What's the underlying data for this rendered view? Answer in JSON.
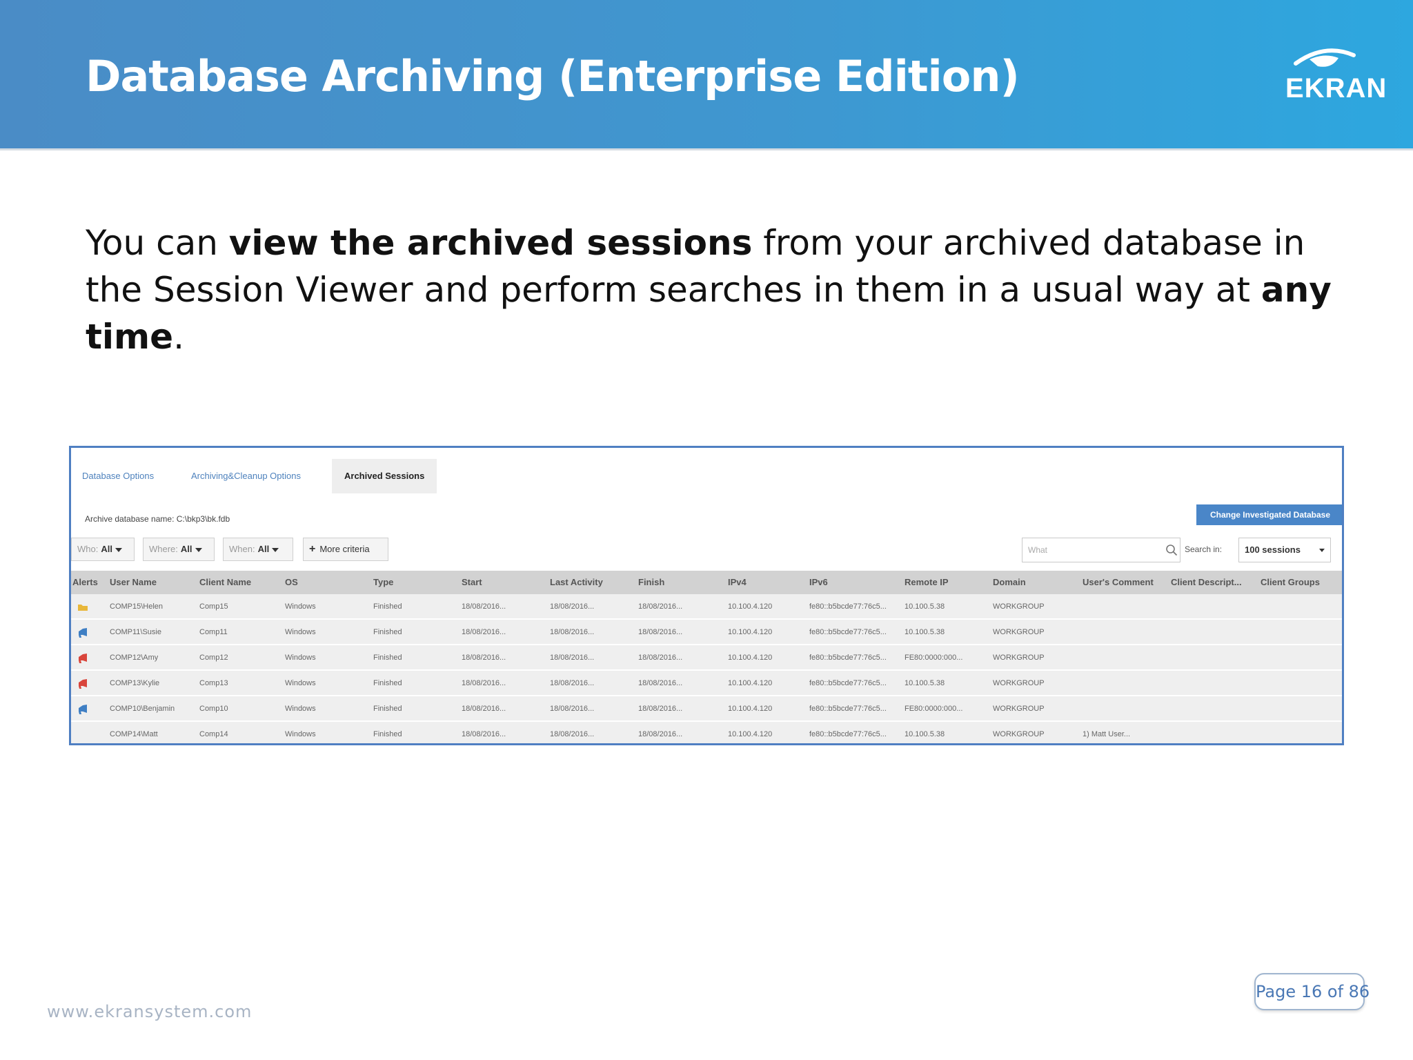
{
  "header": {
    "title": "Database Archiving (Enterprise Edition)",
    "logo_text": "EKRAN"
  },
  "intro": {
    "part1": "You can ",
    "bold1": "view the archived sessions",
    "part2": " from your archived database in the Session Viewer and perform searches in them in a usual way at ",
    "bold2": "any time",
    "part3": "."
  },
  "screenshot": {
    "tabs": [
      {
        "label": "Database Options",
        "active": false
      },
      {
        "label": "Archiving&Cleanup Options",
        "active": false
      },
      {
        "label": "Archived Sessions",
        "active": true
      }
    ],
    "archive_name": "Archive database name: C:\\bkp3\\bk.fdb",
    "change_db_button": "Change Investigated Database",
    "filters": {
      "who_label": "Who:",
      "who_value": "All",
      "where_label": "Where:",
      "where_value": "All",
      "when_label": "When:",
      "when_value": "All",
      "more_criteria": "More criteria"
    },
    "search": {
      "placeholder": "What",
      "search_in_label": "Search in:",
      "search_in_value": "100 sessions"
    },
    "columns": [
      "Alerts",
      "User Name",
      "Client Name",
      "OS",
      "Type",
      "Start",
      "Last Activity",
      "Finish",
      "IPv4",
      "IPv6",
      "Remote IP",
      "Domain",
      "User's Comment",
      "Client Descript...",
      "Client Groups"
    ],
    "rows": [
      {
        "alert": "folder",
        "user": "COMP15\\Helen",
        "client": "Comp15",
        "os": "Windows",
        "type": "Finished",
        "start": "18/08/2016...",
        "last": "18/08/2016...",
        "finish": "18/08/2016...",
        "ipv4": "10.100.4.120",
        "ipv6": "fe80::b5bcde77:76c5...",
        "remote": "10.100.5.38",
        "domain": "WORKGROUP",
        "comment": ""
      },
      {
        "alert": "blue",
        "user": "COMP11\\Susie",
        "client": "Comp11",
        "os": "Windows",
        "type": "Finished",
        "start": "18/08/2016...",
        "last": "18/08/2016...",
        "finish": "18/08/2016...",
        "ipv4": "10.100.4.120",
        "ipv6": "fe80::b5bcde77:76c5...",
        "remote": "10.100.5.38",
        "domain": "WORKGROUP",
        "comment": ""
      },
      {
        "alert": "red",
        "user": "COMP12\\Amy",
        "client": "Comp12",
        "os": "Windows",
        "type": "Finished",
        "start": "18/08/2016...",
        "last": "18/08/2016...",
        "finish": "18/08/2016...",
        "ipv4": "10.100.4.120",
        "ipv6": "fe80::b5bcde77:76c5...",
        "remote": "FE80:0000:000...",
        "domain": "WORKGROUP",
        "comment": ""
      },
      {
        "alert": "red",
        "user": "COMP13\\Kylie",
        "client": "Comp13",
        "os": "Windows",
        "type": "Finished",
        "start": "18/08/2016...",
        "last": "18/08/2016...",
        "finish": "18/08/2016...",
        "ipv4": "10.100.4.120",
        "ipv6": "fe80::b5bcde77:76c5...",
        "remote": "10.100.5.38",
        "domain": "WORKGROUP",
        "comment": ""
      },
      {
        "alert": "blue",
        "user": "COMP10\\Benjamin",
        "client": "Comp10",
        "os": "Windows",
        "type": "Finished",
        "start": "18/08/2016...",
        "last": "18/08/2016...",
        "finish": "18/08/2016...",
        "ipv4": "10.100.4.120",
        "ipv6": "fe80::b5bcde77:76c5...",
        "remote": "FE80:0000:000...",
        "domain": "WORKGROUP",
        "comment": ""
      },
      {
        "alert": "none",
        "user": "COMP14\\Matt",
        "client": "Comp14",
        "os": "Windows",
        "type": "Finished",
        "start": "18/08/2016...",
        "last": "18/08/2016...",
        "finish": "18/08/2016...",
        "ipv4": "10.100.4.120",
        "ipv6": "fe80::b5bcde77:76c5...",
        "remote": "10.100.5.38",
        "domain": "WORKGROUP",
        "comment": "1) Matt User..."
      }
    ]
  },
  "footer": {
    "url": "www.ekransystem.com",
    "page": "Page 16 of 86"
  },
  "colors": {
    "banner_start": "#4a8cc6",
    "banner_end": "#2da7df",
    "frame_border": "#4f7fc2",
    "button_blue": "#4a86c8",
    "alert_red": "#d9453b",
    "alert_blue": "#3f7fc4",
    "alert_yellow": "#e8b73a"
  }
}
